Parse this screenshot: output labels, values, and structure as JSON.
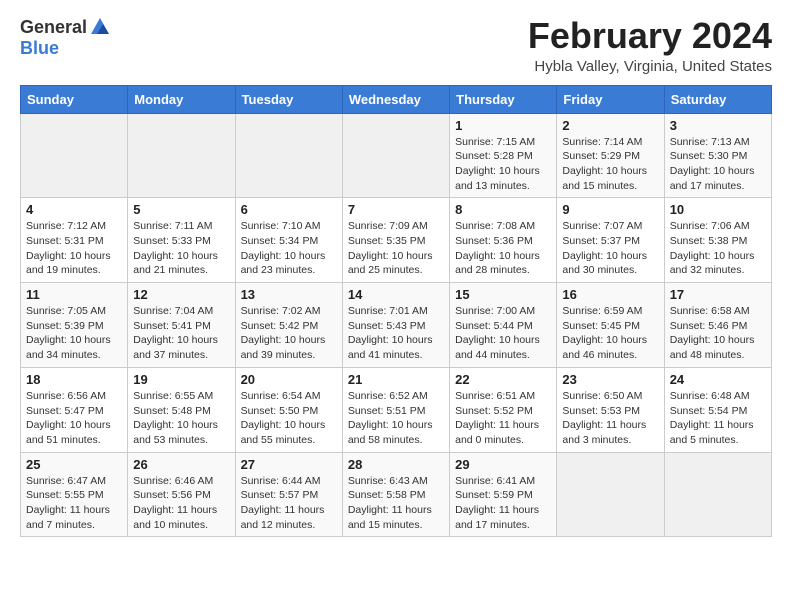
{
  "header": {
    "logo": {
      "general": "General",
      "blue": "Blue"
    },
    "title": "February 2024",
    "location": "Hybla Valley, Virginia, United States"
  },
  "days_of_week": [
    "Sunday",
    "Monday",
    "Tuesday",
    "Wednesday",
    "Thursday",
    "Friday",
    "Saturday"
  ],
  "weeks": [
    [
      {
        "day": "",
        "info": ""
      },
      {
        "day": "",
        "info": ""
      },
      {
        "day": "",
        "info": ""
      },
      {
        "day": "",
        "info": ""
      },
      {
        "day": "1",
        "info": "Sunrise: 7:15 AM\nSunset: 5:28 PM\nDaylight: 10 hours\nand 13 minutes."
      },
      {
        "day": "2",
        "info": "Sunrise: 7:14 AM\nSunset: 5:29 PM\nDaylight: 10 hours\nand 15 minutes."
      },
      {
        "day": "3",
        "info": "Sunrise: 7:13 AM\nSunset: 5:30 PM\nDaylight: 10 hours\nand 17 minutes."
      }
    ],
    [
      {
        "day": "4",
        "info": "Sunrise: 7:12 AM\nSunset: 5:31 PM\nDaylight: 10 hours\nand 19 minutes."
      },
      {
        "day": "5",
        "info": "Sunrise: 7:11 AM\nSunset: 5:33 PM\nDaylight: 10 hours\nand 21 minutes."
      },
      {
        "day": "6",
        "info": "Sunrise: 7:10 AM\nSunset: 5:34 PM\nDaylight: 10 hours\nand 23 minutes."
      },
      {
        "day": "7",
        "info": "Sunrise: 7:09 AM\nSunset: 5:35 PM\nDaylight: 10 hours\nand 25 minutes."
      },
      {
        "day": "8",
        "info": "Sunrise: 7:08 AM\nSunset: 5:36 PM\nDaylight: 10 hours\nand 28 minutes."
      },
      {
        "day": "9",
        "info": "Sunrise: 7:07 AM\nSunset: 5:37 PM\nDaylight: 10 hours\nand 30 minutes."
      },
      {
        "day": "10",
        "info": "Sunrise: 7:06 AM\nSunset: 5:38 PM\nDaylight: 10 hours\nand 32 minutes."
      }
    ],
    [
      {
        "day": "11",
        "info": "Sunrise: 7:05 AM\nSunset: 5:39 PM\nDaylight: 10 hours\nand 34 minutes."
      },
      {
        "day": "12",
        "info": "Sunrise: 7:04 AM\nSunset: 5:41 PM\nDaylight: 10 hours\nand 37 minutes."
      },
      {
        "day": "13",
        "info": "Sunrise: 7:02 AM\nSunset: 5:42 PM\nDaylight: 10 hours\nand 39 minutes."
      },
      {
        "day": "14",
        "info": "Sunrise: 7:01 AM\nSunset: 5:43 PM\nDaylight: 10 hours\nand 41 minutes."
      },
      {
        "day": "15",
        "info": "Sunrise: 7:00 AM\nSunset: 5:44 PM\nDaylight: 10 hours\nand 44 minutes."
      },
      {
        "day": "16",
        "info": "Sunrise: 6:59 AM\nSunset: 5:45 PM\nDaylight: 10 hours\nand 46 minutes."
      },
      {
        "day": "17",
        "info": "Sunrise: 6:58 AM\nSunset: 5:46 PM\nDaylight: 10 hours\nand 48 minutes."
      }
    ],
    [
      {
        "day": "18",
        "info": "Sunrise: 6:56 AM\nSunset: 5:47 PM\nDaylight: 10 hours\nand 51 minutes."
      },
      {
        "day": "19",
        "info": "Sunrise: 6:55 AM\nSunset: 5:48 PM\nDaylight: 10 hours\nand 53 minutes."
      },
      {
        "day": "20",
        "info": "Sunrise: 6:54 AM\nSunset: 5:50 PM\nDaylight: 10 hours\nand 55 minutes."
      },
      {
        "day": "21",
        "info": "Sunrise: 6:52 AM\nSunset: 5:51 PM\nDaylight: 10 hours\nand 58 minutes."
      },
      {
        "day": "22",
        "info": "Sunrise: 6:51 AM\nSunset: 5:52 PM\nDaylight: 11 hours\nand 0 minutes."
      },
      {
        "day": "23",
        "info": "Sunrise: 6:50 AM\nSunset: 5:53 PM\nDaylight: 11 hours\nand 3 minutes."
      },
      {
        "day": "24",
        "info": "Sunrise: 6:48 AM\nSunset: 5:54 PM\nDaylight: 11 hours\nand 5 minutes."
      }
    ],
    [
      {
        "day": "25",
        "info": "Sunrise: 6:47 AM\nSunset: 5:55 PM\nDaylight: 11 hours\nand 7 minutes."
      },
      {
        "day": "26",
        "info": "Sunrise: 6:46 AM\nSunset: 5:56 PM\nDaylight: 11 hours\nand 10 minutes."
      },
      {
        "day": "27",
        "info": "Sunrise: 6:44 AM\nSunset: 5:57 PM\nDaylight: 11 hours\nand 12 minutes."
      },
      {
        "day": "28",
        "info": "Sunrise: 6:43 AM\nSunset: 5:58 PM\nDaylight: 11 hours\nand 15 minutes."
      },
      {
        "day": "29",
        "info": "Sunrise: 6:41 AM\nSunset: 5:59 PM\nDaylight: 11 hours\nand 17 minutes."
      },
      {
        "day": "",
        "info": ""
      },
      {
        "day": "",
        "info": ""
      }
    ]
  ]
}
